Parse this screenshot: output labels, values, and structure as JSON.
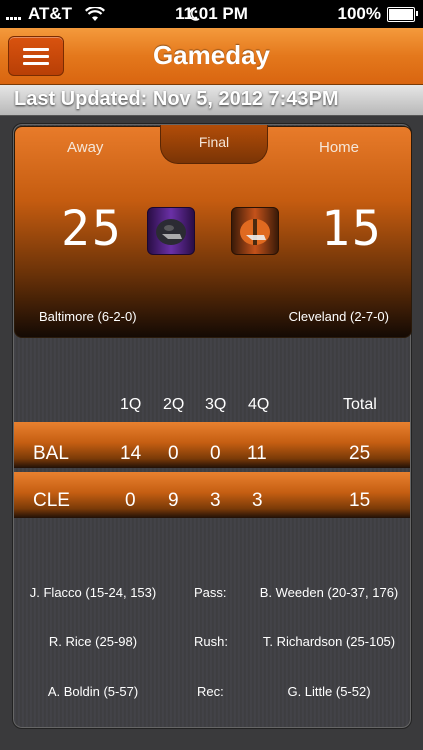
{
  "status_bar": {
    "carrier": "AT&T",
    "time": "11:01 PM",
    "battery": "100%",
    "icons": [
      "signal-icon",
      "wifi-icon",
      "moon-icon",
      "battery-icon"
    ]
  },
  "nav": {
    "title": "Gameday",
    "menu_icon": "hamburger-icon"
  },
  "updated": {
    "text": "Last Updated: Nov 5, 2012 7:43PM"
  },
  "game": {
    "away_label": "Away",
    "home_label": "Home",
    "status": "Final",
    "away_score": "25",
    "home_score": "15",
    "away_team": "Baltimore (6-2-0)",
    "home_team": "Cleveland (2-7-0)",
    "away_helmet_color": "#5a2a8a",
    "home_helmet_color": "#e0601a"
  },
  "linescore": {
    "headers": [
      "1Q",
      "2Q",
      "3Q",
      "4Q",
      "Total"
    ],
    "rows": [
      {
        "team": "BAL",
        "q": [
          "14",
          "0",
          "0",
          "11"
        ],
        "total": "25"
      },
      {
        "team": "CLE",
        "q": [
          "0",
          "9",
          "3",
          "3"
        ],
        "total": "15"
      }
    ]
  },
  "stats": [
    {
      "label": "Pass:",
      "away": "J. Flacco (15-24, 153)",
      "home": "B. Weeden (20-37, 176)"
    },
    {
      "label": "Rush:",
      "away": "R. Rice (25-98)",
      "home": "T. Richardson (25-105)"
    },
    {
      "label": "Rec:",
      "away": "A. Boldin (5-57)",
      "home": "G. Little (5-52)"
    }
  ],
  "colors": {
    "accent": "#e4781c",
    "panel": "#3d3d40"
  }
}
